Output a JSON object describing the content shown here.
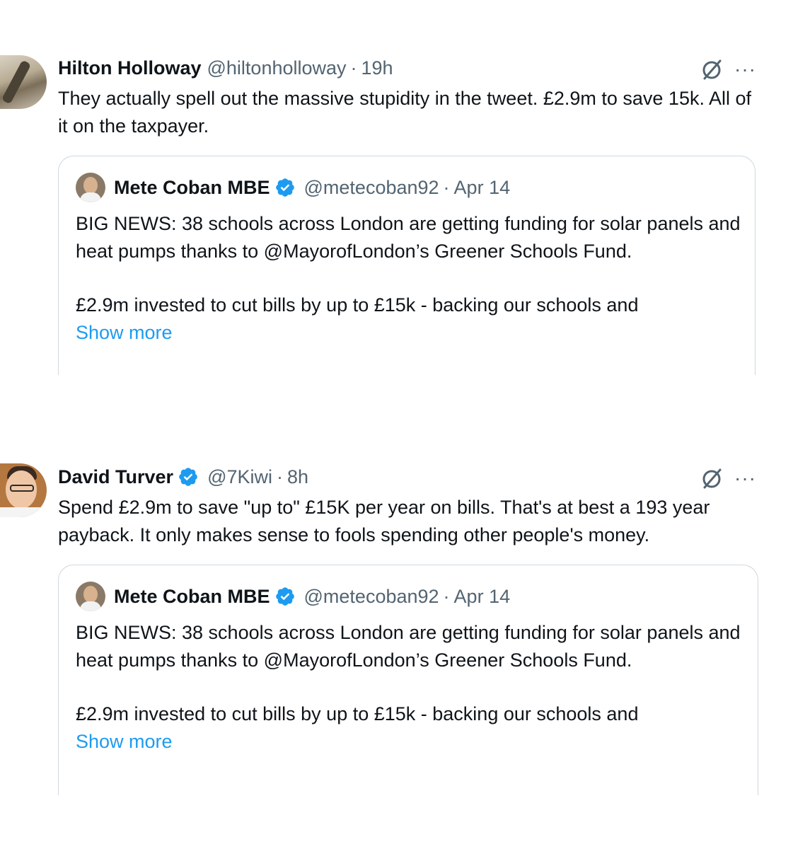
{
  "tweets": [
    {
      "author": {
        "name": "Hilton Holloway",
        "handle": "@hiltonholloway",
        "verified": false
      },
      "time": "19h",
      "separator": "·",
      "text": "They actually spell out the massive stupidity in the tweet. £2.9m to save 15k. All of it on the taxpayer.",
      "quoted": {
        "name": "Mete Coban MBE",
        "handle": "@metecoban92",
        "verified": true,
        "time": "Apr 14",
        "separator": "·",
        "paragraph1": "BIG NEWS: 38 schools across London are getting funding for solar panels and heat pumps thanks to @MayorofLondon’s Greener Schools Fund.",
        "paragraph2": "£2.9m invested to cut bills by up to £15k - backing our schools and",
        "show_more": "Show more"
      }
    },
    {
      "author": {
        "name": "David Turver",
        "handle": "@7Kiwi",
        "verified": true
      },
      "time": "8h",
      "separator": "·",
      "text": "Spend £2.9m to save \"up to\" £15K per year on bills. That's at best a 193 year payback. It only makes sense to fools spending other people's money.",
      "quoted": {
        "name": "Mete Coban MBE",
        "handle": "@metecoban92",
        "verified": true,
        "time": "Apr 14",
        "separator": "·",
        "paragraph1": "BIG NEWS: 38 schools across London are getting funding for solar panels and heat pumps thanks to @MayorofLondon’s Greener Schools Fund.",
        "paragraph2": "£2.9m invested to cut bills by up to £15k - backing our schools and",
        "show_more": "Show more"
      }
    }
  ],
  "icons": {
    "verified": "verified-badge-icon",
    "grok": "grok-icon",
    "more": "more-options-icon",
    "more_glyph": "···"
  },
  "colors": {
    "link": "#1d9bf0",
    "secondary": "#536471",
    "border": "#cfd9de",
    "verified": "#1d9bf0"
  }
}
